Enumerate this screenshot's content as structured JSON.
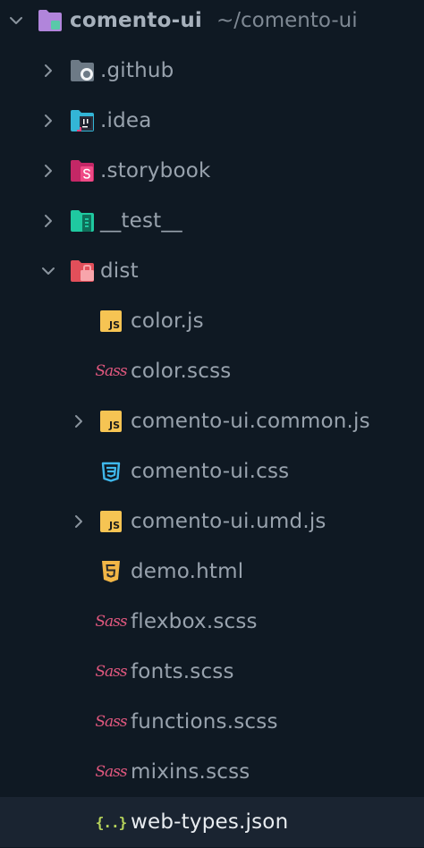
{
  "explorer": {
    "root": {
      "name": "comento-ui",
      "path": "~/comento-ui",
      "expanded": true,
      "icon": "folder-purple-icon"
    },
    "items": [
      {
        "name": ".github",
        "type": "folder",
        "expanded": false,
        "icon": "folder-github-icon",
        "color": "#6d7a86"
      },
      {
        "name": ".idea",
        "type": "folder",
        "expanded": false,
        "icon": "folder-idea-icon",
        "color": "#33b5d6"
      },
      {
        "name": ".storybook",
        "type": "folder",
        "expanded": false,
        "icon": "folder-storybook-icon",
        "color": "#d12d6c"
      },
      {
        "name": "__test__",
        "type": "folder",
        "expanded": false,
        "icon": "folder-test-icon",
        "color": "#22c9a4"
      },
      {
        "name": "dist",
        "type": "folder",
        "expanded": true,
        "icon": "folder-dist-icon",
        "color": "#e8555f"
      },
      {
        "name": "color.js",
        "type": "file",
        "icon": "javascript-icon"
      },
      {
        "name": "color.scss",
        "type": "file",
        "icon": "sass-icon"
      },
      {
        "name": "comento-ui.common.js",
        "type": "file",
        "expandable": true,
        "expanded": false,
        "icon": "javascript-icon"
      },
      {
        "name": "comento-ui.css",
        "type": "file",
        "icon": "css-icon"
      },
      {
        "name": "comento-ui.umd.js",
        "type": "file",
        "expandable": true,
        "expanded": false,
        "icon": "javascript-icon"
      },
      {
        "name": "demo.html",
        "type": "file",
        "icon": "html-icon"
      },
      {
        "name": "flexbox.scss",
        "type": "file",
        "icon": "sass-icon"
      },
      {
        "name": "fonts.scss",
        "type": "file",
        "icon": "sass-icon"
      },
      {
        "name": "functions.scss",
        "type": "file",
        "icon": "sass-icon"
      },
      {
        "name": "mixins.scss",
        "type": "file",
        "icon": "sass-icon"
      },
      {
        "name": "web-types.json",
        "type": "file",
        "selected": true,
        "icon": "json-icon"
      }
    ],
    "icon_text": {
      "js": "JS",
      "sass": "Sass",
      "json": "{..}"
    },
    "colors": {
      "background": "#0f1923",
      "selected_row": "#1a2431",
      "text": "#98a2ad",
      "selected_text": "#e8ecf0",
      "chevron": "#8a949e"
    }
  }
}
